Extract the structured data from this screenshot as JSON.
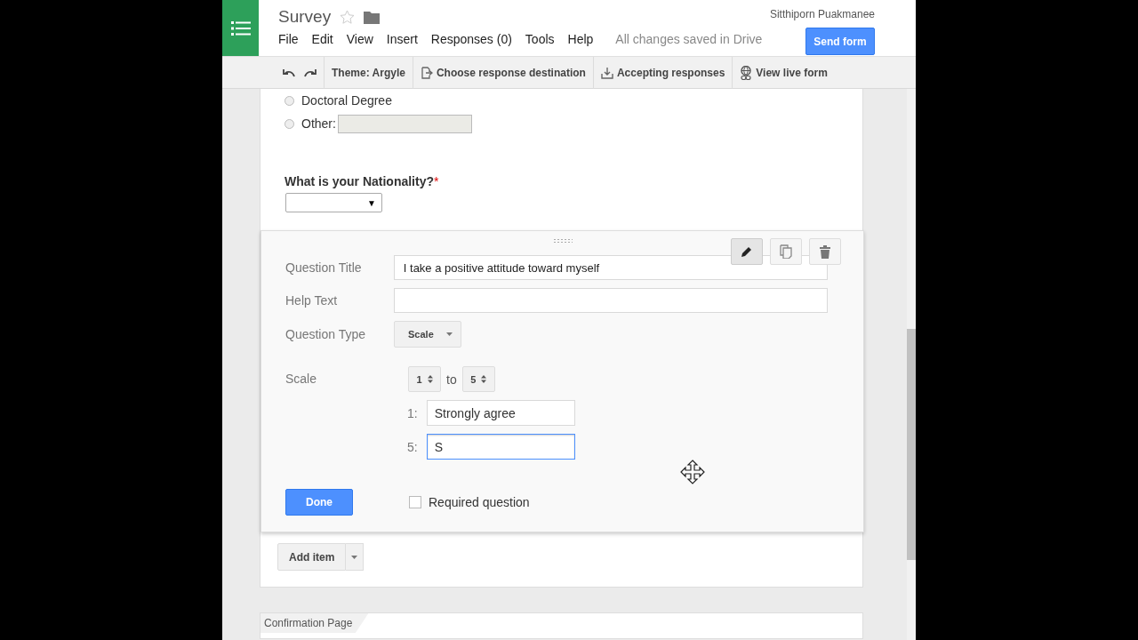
{
  "app": {
    "title": "Survey",
    "starred": false,
    "user": "Sitthiporn Puakmanee",
    "save_status": "All changes saved in Drive",
    "send_button": "Send form",
    "menu": [
      "File",
      "Edit",
      "View",
      "Insert",
      "Responses (0)",
      "Tools",
      "Help"
    ]
  },
  "toolbar": {
    "theme": "Theme: Argyle",
    "items": [
      {
        "label": "Choose response destination",
        "kind": "destination"
      },
      {
        "label": "Accepting responses",
        "kind": "accepting"
      },
      {
        "label": "View live form",
        "kind": "live"
      }
    ]
  },
  "previous": {
    "options": [
      {
        "label": "Doctoral Degree",
        "kind": "plain",
        "selected": false
      },
      {
        "label": "Other:",
        "kind": "other",
        "selected": false
      }
    ],
    "question": {
      "title": "What is your Nationality?",
      "required_mark": "*",
      "dropdown_arrow": "▼"
    }
  },
  "editor": {
    "actions": [
      {
        "kind": "edit",
        "selected": true
      },
      {
        "kind": "duplicate",
        "selected": false
      },
      {
        "kind": "delete",
        "selected": false
      }
    ],
    "title": {
      "label": "Question Title",
      "value": "I take a positive attitude toward myself"
    },
    "help": {
      "label": "Help Text"
    },
    "type": {
      "label": "Question Type",
      "value": "Scale"
    },
    "scale": {
      "label": "Scale",
      "from": "1",
      "to_word": "to",
      "to": "5",
      "anchors": [
        {
          "prefix": "1:",
          "value": "Strongly agree",
          "focused": false
        },
        {
          "prefix": "5:",
          "value": "S",
          "focused": true
        }
      ]
    },
    "done": "Done",
    "required": {
      "label": "Required question",
      "checked": false
    }
  },
  "add_item": "Add item",
  "confirmation": "Confirmation Page"
}
